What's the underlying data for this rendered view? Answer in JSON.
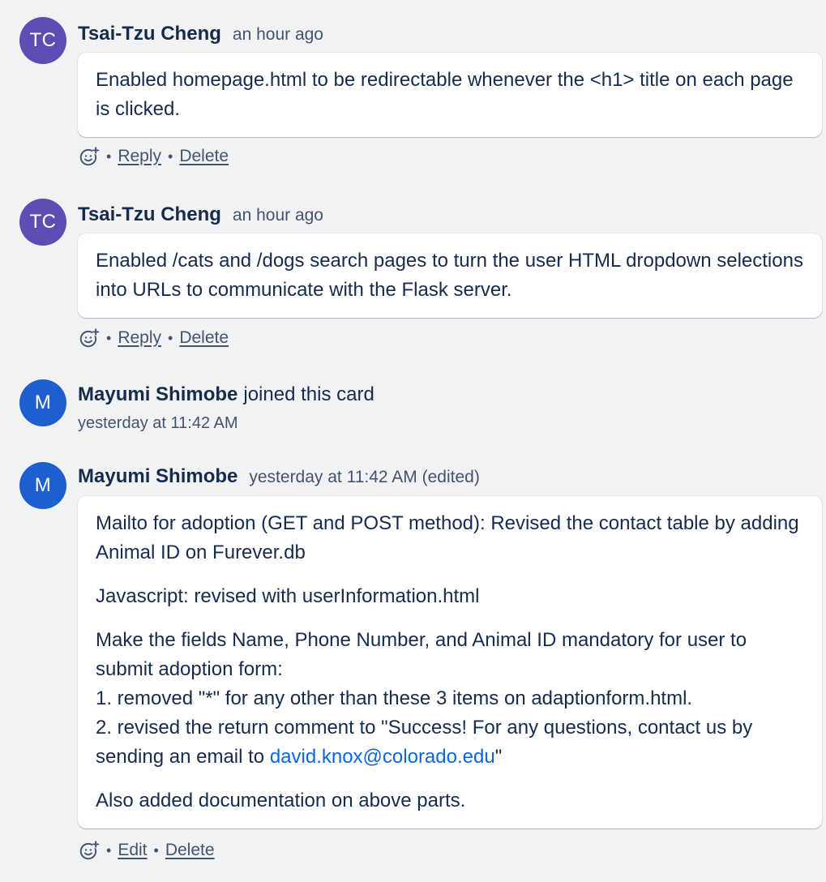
{
  "activity": [
    {
      "avatar_initials": "TC",
      "author": "Tsai-Tzu Cheng",
      "timestamp": "an hour ago",
      "paragraphs": [
        "Enabled homepage.html to be redirectable whenever the <h1> title on each page is clicked."
      ],
      "actions": {
        "first": "Reply",
        "second": "Delete"
      }
    },
    {
      "avatar_initials": "TC",
      "author": "Tsai-Tzu Cheng",
      "timestamp": "an hour ago",
      "paragraphs": [
        "Enabled /cats and /dogs search pages to turn the user HTML dropdown selections into URLs to communicate with the Flask server."
      ],
      "actions": {
        "first": "Reply",
        "second": "Delete"
      }
    },
    {
      "avatar_initials": "M",
      "author": "Mayumi Shimobe",
      "event_text": "joined this card",
      "timestamp": "yesterday at 11:42 AM"
    },
    {
      "avatar_initials": "M",
      "author": "Mayumi Shimobe",
      "timestamp": "yesterday at 11:42 AM (edited)",
      "paragraphs": [
        "Mailto for adoption (GET and POST method): Revised the contact table by adding Animal ID on Furever.db",
        "Javascript: revised with userInformation.html"
      ],
      "para3_lines": [
        "Make the fields Name, Phone Number, and Animal ID mandatory for user to submit adoption form:",
        "1. removed \"*\" for any other than these 3 items on adaptionform.html."
      ],
      "para3_line3_before": "2. revised the return comment to \"Success! For any questions, contact us by sending an email to ",
      "para3_email": "david.knox@colorado.edu",
      "para3_line3_after": "\"",
      "para4": "Also added documentation on above parts.",
      "actions": {
        "first": "Edit",
        "second": "Delete"
      }
    }
  ],
  "colors": {
    "avatar_tc": "#5e4db2",
    "avatar_m": "#1d5fcf",
    "link": "#0c66e4",
    "background": "#f1f2f4"
  },
  "icons": {
    "reaction": "add-reaction-icon"
  }
}
